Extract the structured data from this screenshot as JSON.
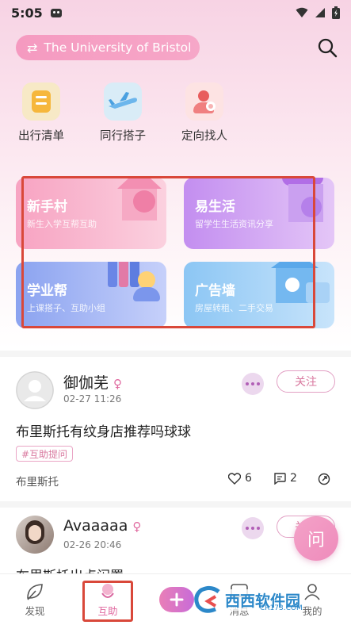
{
  "status_bar": {
    "time": "5:05"
  },
  "header": {
    "school": "The University of Bristol"
  },
  "quick_actions": [
    {
      "label": "出行清单",
      "icon": "checklist-icon"
    },
    {
      "label": "同行搭子",
      "icon": "airplane-icon"
    },
    {
      "label": "定向找人",
      "icon": "find-person-icon"
    }
  ],
  "sections": [
    {
      "title": "新手村",
      "subtitle": "新生入学互帮互助"
    },
    {
      "title": "易生活",
      "subtitle": "留学生生活资讯分享"
    },
    {
      "title": "学业帮",
      "subtitle": "上课搭子、互助小组"
    },
    {
      "title": "广告墙",
      "subtitle": "房屋转租、二手交易"
    }
  ],
  "posts": [
    {
      "author": "御伽芜",
      "gender": "♀",
      "time": "02-27 11:26",
      "follow_label": "关注",
      "title": "布里斯托有纹身店推荐吗球球",
      "tag": "#互助提问",
      "location": "布里斯托",
      "likes": "6",
      "comments": "2"
    },
    {
      "author": "Avaaaaa",
      "gender": "♀",
      "time": "02-26 20:46",
      "follow_label": "关注",
      "title": "布里斯托出点闲置"
    }
  ],
  "fab_label": "问",
  "tabbar": {
    "discover": "发现",
    "help": "互助",
    "messages": "消息",
    "me": "我的"
  },
  "watermark": {
    "brand": "西西软件园",
    "url": "CR173.COM"
  },
  "colors": {
    "accent": "#ee8bbb",
    "highlight_box": "#d9483a"
  }
}
